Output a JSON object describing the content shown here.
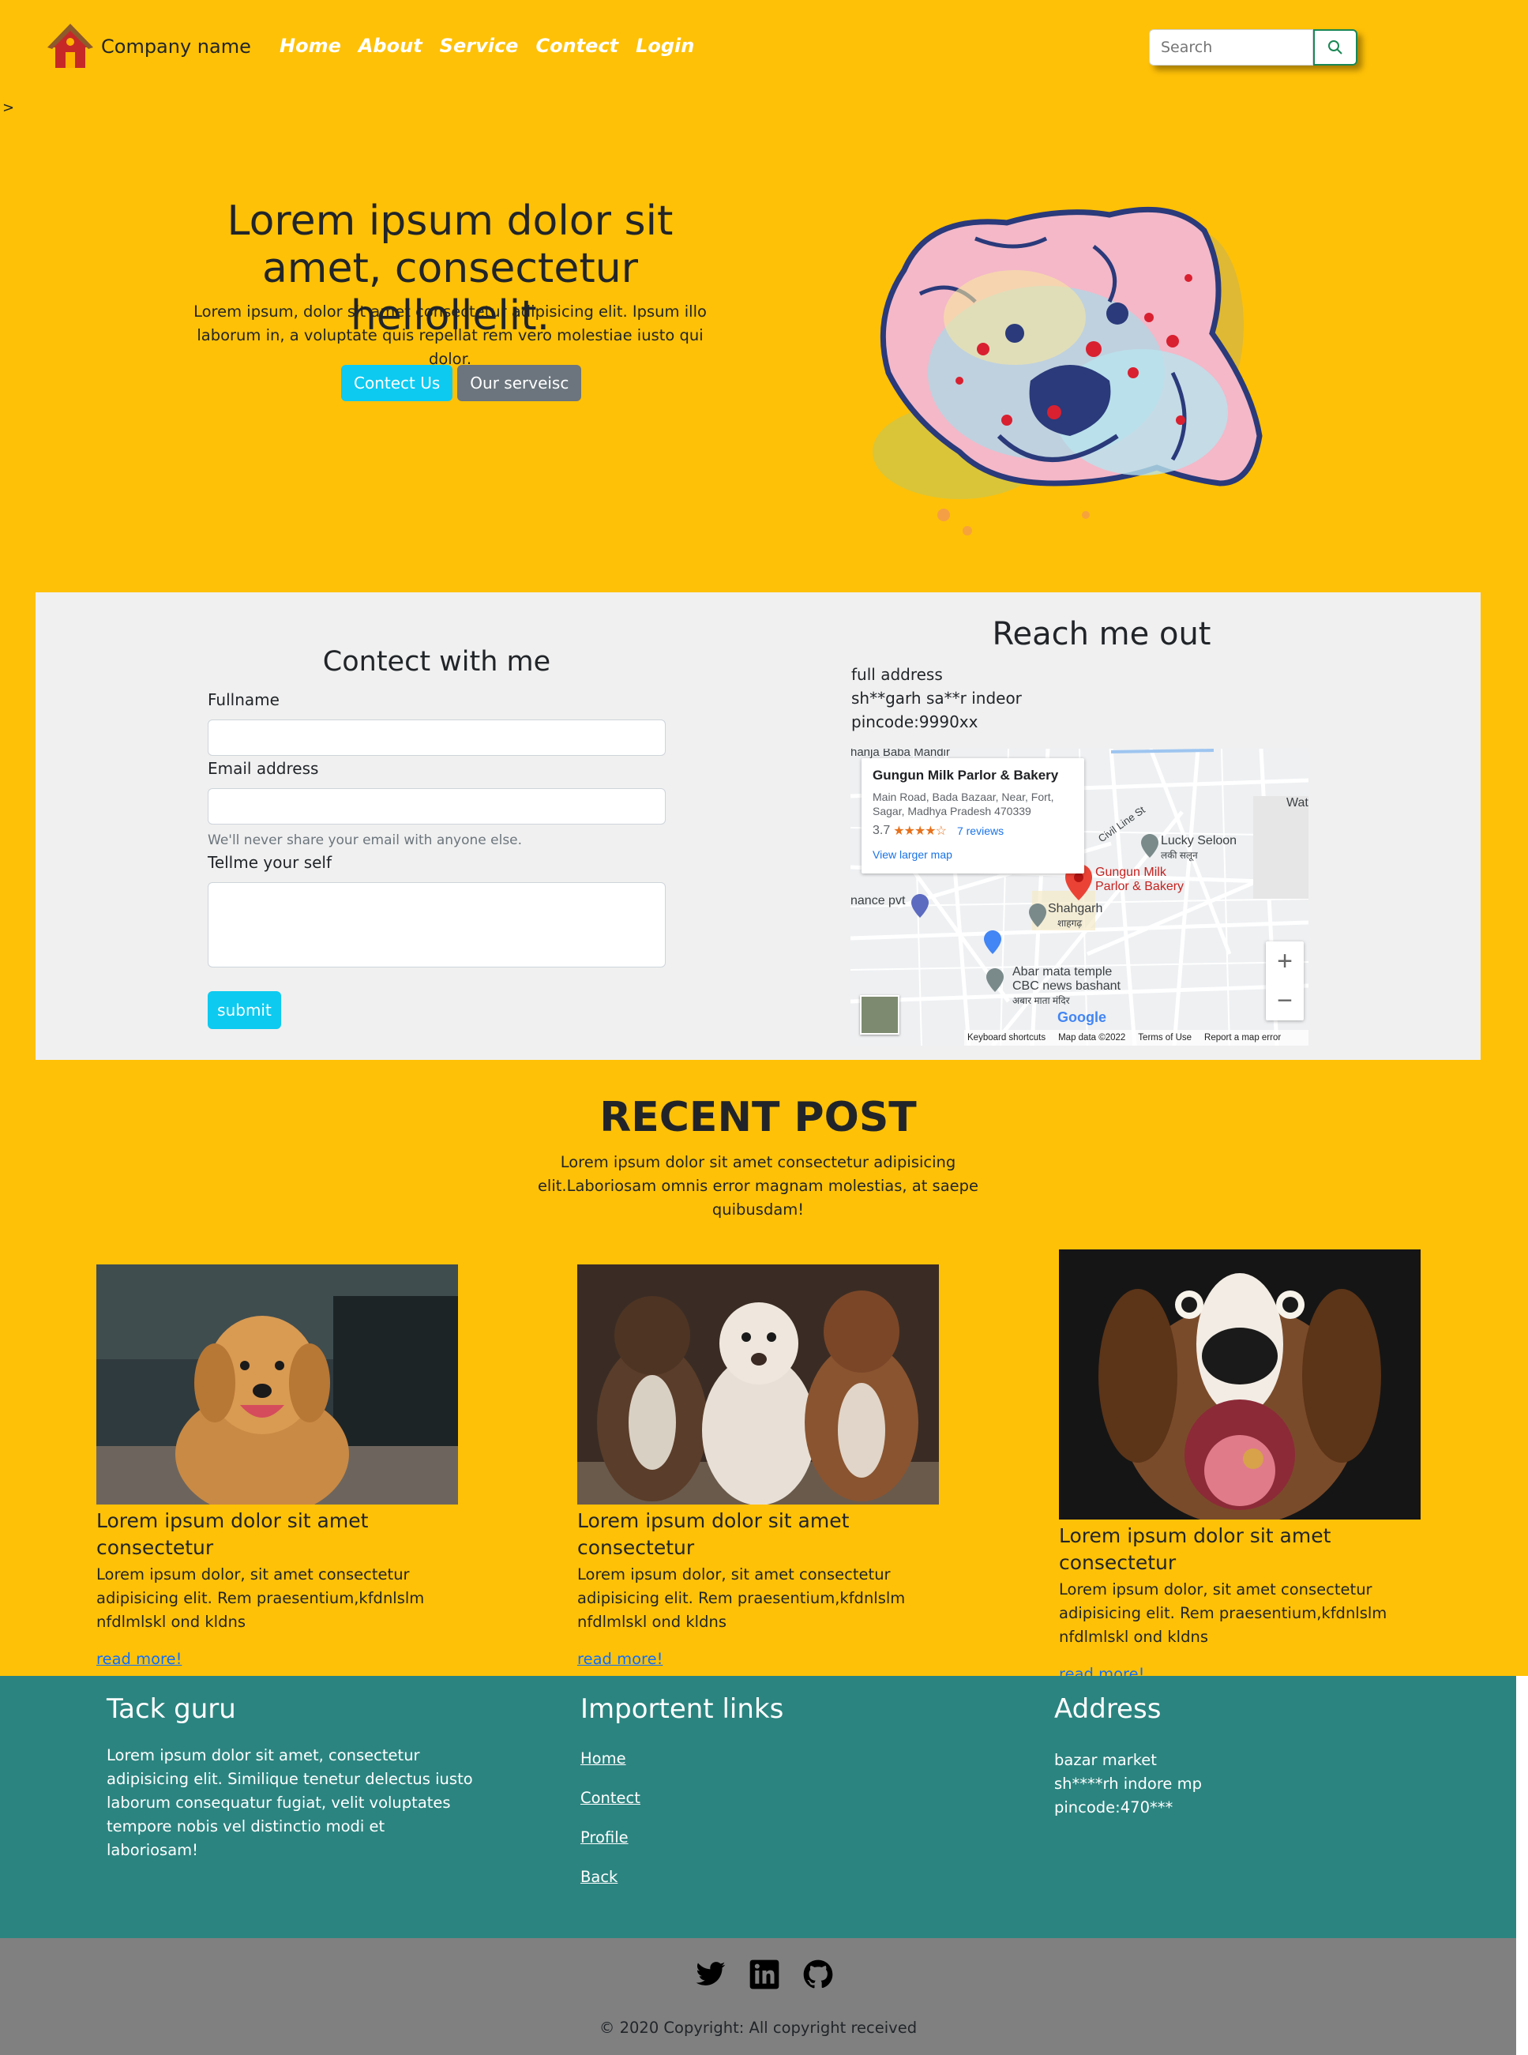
{
  "nav": {
    "brand": "Company name",
    "links": [
      "Home",
      "About",
      "Service",
      "Contect",
      "Login"
    ],
    "search_placeholder": "Search",
    "stray_text": ">"
  },
  "hero": {
    "title": "Lorem ipsum dolor sit amet, consectetur hellollelit.",
    "text": "Lorem ipsum, dolor sit amet consectetur adipisicing elit. Ipsum illo laborum in, a voluptate quis repellat rem vero molestiae iusto qui dolor.",
    "btn_primary": "Contect Us",
    "btn_secondary": "Our serveisc"
  },
  "contact": {
    "title": "Contect with me",
    "fullname_label": "Fullname",
    "email_label": "Email address",
    "email_help": "We'll never share your email with anyone else.",
    "about_label": "Tellme your self",
    "submit": "submit"
  },
  "reach": {
    "title": "Reach me out",
    "lines": [
      "full address",
      "sh**garh sa**r indeor",
      "pincode:9990xx"
    ]
  },
  "map": {
    "place_name": "Gungun Milk Parlor & Bakery",
    "place_address": "Main Road, Bada Bazaar, Near, Fort, Sagar, Madhya Pradesh 470339",
    "rating": "3.7",
    "stars": "★★★★☆",
    "reviews": "7 reviews",
    "larger_map": "View larger map",
    "labels": {
      "top_left": "hanja Baba Mandir",
      "lucky": "Lucky Seloon",
      "lucky_sub": "लकी सलून",
      "pin_label_1": "Gungun Milk",
      "pin_label_2": "Parlor & Bakery",
      "shahgarh": "Shahgarh",
      "shahgarh_sub": "शाहगढ़",
      "civil": "Civil Line St",
      "temple_1": "Abar mata temple",
      "temple_2": "CBC news bashant",
      "temple_sub": "अबार माता मंदिर",
      "finance": "nance pvt",
      "right_edge": "Wat"
    },
    "zoom_in": "+",
    "zoom_out": "−",
    "google": "Google",
    "footer": [
      "Keyboard shortcuts",
      "Map data ©2022",
      "Terms of Use",
      "Report a map error"
    ]
  },
  "recent": {
    "title": "RECENT POST",
    "text": "Lorem ipsum dolor sit amet consectetur adipisicing elit.Laboriosam omnis error magnam molestias, at saepe quibusdam!",
    "posts": [
      {
        "title": "Lorem ipsum dolor sit amet consectetur",
        "text": "Lorem ipsum dolor, sit amet consectetur adipisicing elit. Rem praesentium,kfdnlslm nfdlmlskl ond kldns",
        "link": "read more!"
      },
      {
        "title": "Lorem ipsum dolor sit amet consectetur",
        "text": "Lorem ipsum dolor, sit amet consectetur adipisicing elit. Rem praesentium,kfdnlslm nfdlmlskl ond kldns",
        "link": "read more!"
      },
      {
        "title": "Lorem ipsum dolor sit amet consectetur",
        "text": "Lorem ipsum dolor, sit amet consectetur adipisicing elit. Rem praesentium,kfdnlslm nfdlmlskl ond kldns",
        "link": "read more!"
      }
    ]
  },
  "footer": {
    "about_title": "Tack guru",
    "about_text": "Lorem ipsum dolor sit amet, consectetur adipisicing elit. Similique tenetur delectus iusto laborum consequatur fugiat, velit voluptates tempore nobis vel distinctio modi et laboriosam!",
    "links_title": "Importent links",
    "links": [
      "Home",
      "Contect",
      "Profile",
      "Back"
    ],
    "address_title": "Address",
    "address_lines": [
      "bazar market",
      "sh****rh indore mp",
      "pincode:470***"
    ],
    "social_icons": [
      "twitter-icon",
      "linkedin-icon",
      "github-icon"
    ],
    "copyright": "© 2020 Copyright: All copyright received"
  },
  "colors": {
    "background": "#ffc107",
    "footer": "#2b8480",
    "bottom_bar": "#808080",
    "cyan_button": "#0dcaf0",
    "gray_button": "#6c757d"
  }
}
